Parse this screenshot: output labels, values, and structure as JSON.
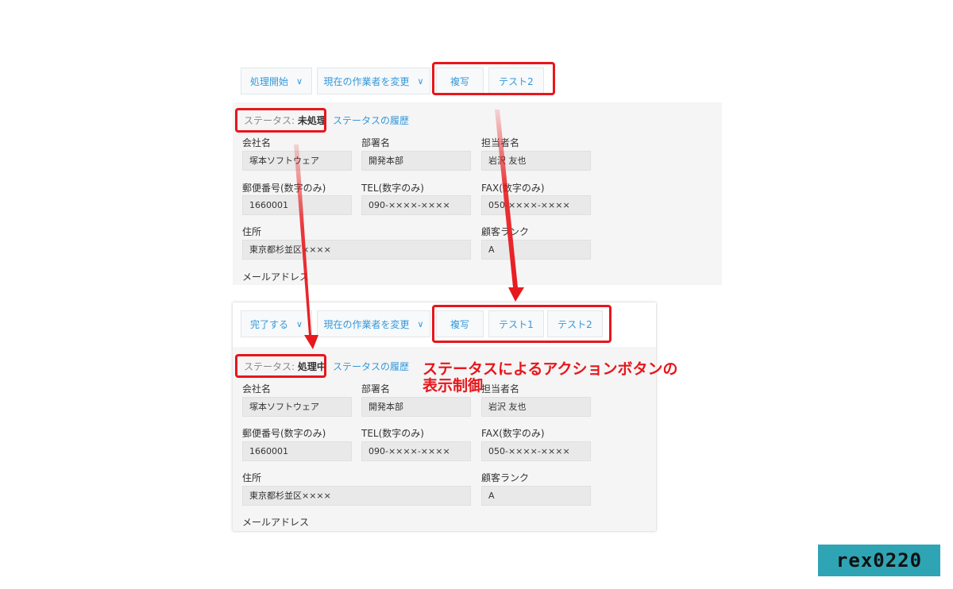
{
  "panel_before": {
    "toolbar": {
      "action_label": "処理開始",
      "assignee_label": "現在の作業者を変更",
      "buttons": [
        "複写",
        "テスト2"
      ]
    },
    "status_prefix": "ステータス: ",
    "status_value": "未処理",
    "history_link": "ステータスの履歴"
  },
  "panel_after": {
    "toolbar": {
      "action_label": "完了する",
      "assignee_label": "現在の作業者を変更",
      "buttons": [
        "複写",
        "テスト1",
        "テスト2"
      ]
    },
    "status_prefix": "ステータス: ",
    "status_value": "処理中",
    "history_link": "ステータスの履歴"
  },
  "form": {
    "company_label": "会社名",
    "company_value": "塚本ソフトウェア",
    "department_label": "部署名",
    "department_value": "開発本部",
    "person_label": "担当者名",
    "person_value": "岩沢 友也",
    "zip_label": "郵便番号(数字のみ)",
    "zip_value": "1660001",
    "tel_label": "TEL(数字のみ)",
    "tel_value": "090-××××-××××",
    "fax_label": "FAX(数字のみ)",
    "fax_value": "050-××××-××××",
    "address_label": "住所",
    "address_value": "東京都杉並区××××",
    "rank_label": "顧客ランク",
    "rank_value": "A",
    "email_label": "メールアドレス"
  },
  "annotation": {
    "line1": "ステータスによるアクションボタンの",
    "line2": "表示制御"
  },
  "watermark": "rex0220",
  "colors": {
    "accent": "#3498db",
    "highlight": "#e8161b",
    "watermark_bg": "#2ea4b4"
  }
}
